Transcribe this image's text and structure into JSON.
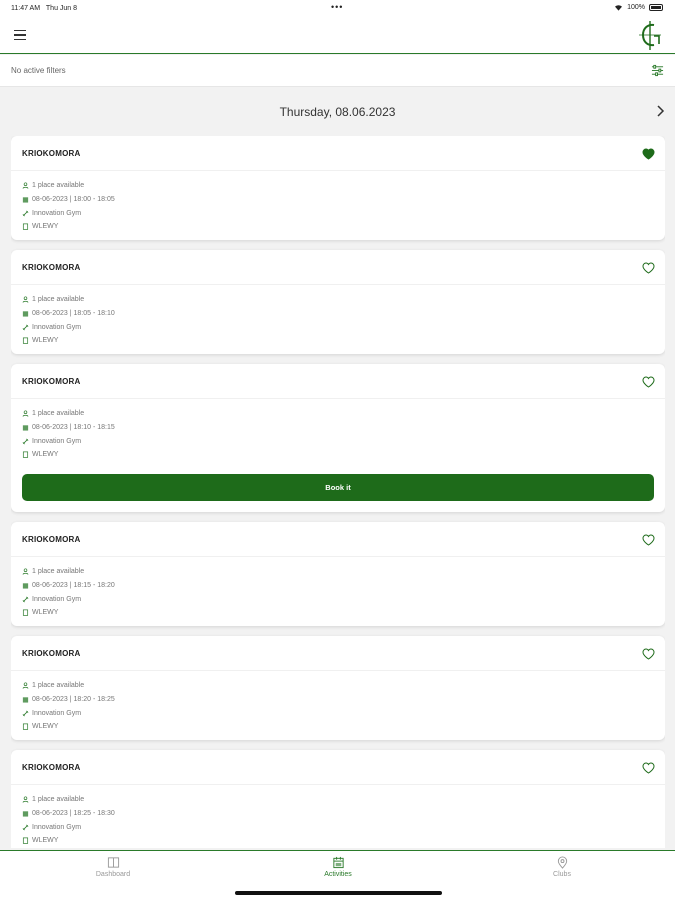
{
  "status_bar": {
    "time": "11:47 AM",
    "date": "Thu Jun 8",
    "battery": "100%"
  },
  "header": {
    "menu_icon": "hamburger-icon",
    "logo_icon": "club-logo-icon"
  },
  "filters": {
    "label": "No active filters",
    "icon": "filter-sliders-icon"
  },
  "date_nav": {
    "title": "Thursday, 08.06.2023",
    "next_icon": "chevron-right-icon"
  },
  "colors": {
    "accent": "#1e6b1a",
    "accent_line": "#2a7a2a",
    "background": "#f2f2f2"
  },
  "activities": [
    {
      "title": "KRIOKOMORA",
      "availability": "1 place available",
      "datetime": "08-06-2023 | 18:00 - 18:05",
      "location": "Innovation Gym",
      "room": "WLEWY",
      "favorited": true,
      "show_book": false
    },
    {
      "title": "KRIOKOMORA",
      "availability": "1 place available",
      "datetime": "08-06-2023 | 18:05 - 18:10",
      "location": "Innovation Gym",
      "room": "WLEWY",
      "favorited": false,
      "show_book": false
    },
    {
      "title": "KRIOKOMORA",
      "availability": "1 place available",
      "datetime": "08-06-2023 | 18:10 - 18:15",
      "location": "Innovation Gym",
      "room": "WLEWY",
      "favorited": false,
      "show_book": true,
      "book_label": "Book it"
    },
    {
      "title": "KRIOKOMORA",
      "availability": "1 place available",
      "datetime": "08-06-2023 | 18:15 - 18:20",
      "location": "Innovation Gym",
      "room": "WLEWY",
      "favorited": false,
      "show_book": false
    },
    {
      "title": "KRIOKOMORA",
      "availability": "1 place available",
      "datetime": "08-06-2023 | 18:20 - 18:25",
      "location": "Innovation Gym",
      "room": "WLEWY",
      "favorited": false,
      "show_book": false
    },
    {
      "title": "KRIOKOMORA",
      "availability": "1 place available",
      "datetime": "08-06-2023 | 18:25 - 18:30",
      "location": "Innovation Gym",
      "room": "WLEWY",
      "favorited": false,
      "show_book": false
    }
  ],
  "tabs": [
    {
      "label": "Dashboard",
      "icon": "dashboard-icon",
      "active": false
    },
    {
      "label": "Activities",
      "icon": "calendar-icon",
      "active": true
    },
    {
      "label": "Clubs",
      "icon": "location-pin-icon",
      "active": false
    }
  ]
}
